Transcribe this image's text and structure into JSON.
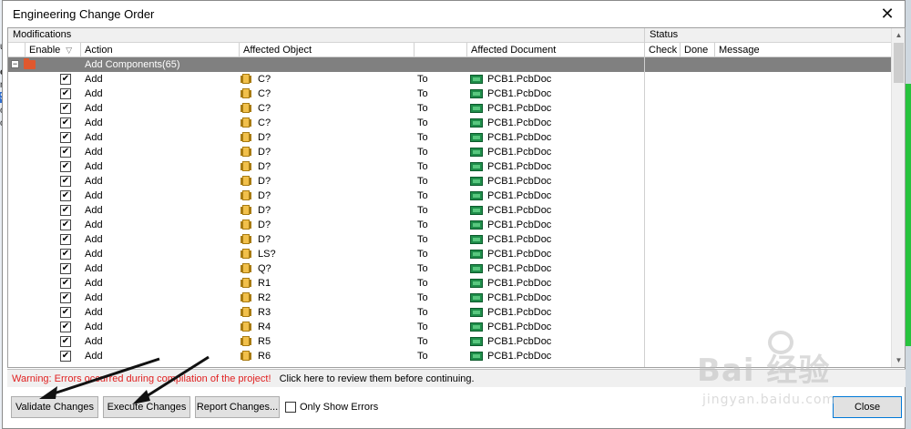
{
  "background": {
    "left_fragments": [
      "ur",
      "c",
      "ne",
      "Se",
      "oc",
      "oc"
    ]
  },
  "dialog": {
    "title": "Engineering Change Order",
    "close_glyph": "✕"
  },
  "grid": {
    "groups": {
      "modifications": "Modifications",
      "status": "Status"
    },
    "columns": {
      "enable": "Enable",
      "action": "Action",
      "affected_object": "Affected Object",
      "affected_document": "Affected Document",
      "check": "Check",
      "done": "Done",
      "message": "Message"
    },
    "group_row": {
      "label": "Add Components(65)",
      "expander": "−"
    },
    "rows": [
      {
        "checked": "✔",
        "action": "Add",
        "object": "C?",
        "to": "To",
        "document": "PCB1.PcbDoc"
      },
      {
        "checked": "✔",
        "action": "Add",
        "object": "C?",
        "to": "To",
        "document": "PCB1.PcbDoc"
      },
      {
        "checked": "✔",
        "action": "Add",
        "object": "C?",
        "to": "To",
        "document": "PCB1.PcbDoc"
      },
      {
        "checked": "✔",
        "action": "Add",
        "object": "C?",
        "to": "To",
        "document": "PCB1.PcbDoc"
      },
      {
        "checked": "✔",
        "action": "Add",
        "object": "D?",
        "to": "To",
        "document": "PCB1.PcbDoc"
      },
      {
        "checked": "✔",
        "action": "Add",
        "object": "D?",
        "to": "To",
        "document": "PCB1.PcbDoc"
      },
      {
        "checked": "✔",
        "action": "Add",
        "object": "D?",
        "to": "To",
        "document": "PCB1.PcbDoc"
      },
      {
        "checked": "✔",
        "action": "Add",
        "object": "D?",
        "to": "To",
        "document": "PCB1.PcbDoc"
      },
      {
        "checked": "✔",
        "action": "Add",
        "object": "D?",
        "to": "To",
        "document": "PCB1.PcbDoc"
      },
      {
        "checked": "✔",
        "action": "Add",
        "object": "D?",
        "to": "To",
        "document": "PCB1.PcbDoc"
      },
      {
        "checked": "✔",
        "action": "Add",
        "object": "D?",
        "to": "To",
        "document": "PCB1.PcbDoc"
      },
      {
        "checked": "✔",
        "action": "Add",
        "object": "D?",
        "to": "To",
        "document": "PCB1.PcbDoc"
      },
      {
        "checked": "✔",
        "action": "Add",
        "object": "LS?",
        "to": "To",
        "document": "PCB1.PcbDoc"
      },
      {
        "checked": "✔",
        "action": "Add",
        "object": "Q?",
        "to": "To",
        "document": "PCB1.PcbDoc"
      },
      {
        "checked": "✔",
        "action": "Add",
        "object": "R1",
        "to": "To",
        "document": "PCB1.PcbDoc"
      },
      {
        "checked": "✔",
        "action": "Add",
        "object": "R2",
        "to": "To",
        "document": "PCB1.PcbDoc"
      },
      {
        "checked": "✔",
        "action": "Add",
        "object": "R3",
        "to": "To",
        "document": "PCB1.PcbDoc"
      },
      {
        "checked": "✔",
        "action": "Add",
        "object": "R4",
        "to": "To",
        "document": "PCB1.PcbDoc"
      },
      {
        "checked": "✔",
        "action": "Add",
        "object": "R5",
        "to": "To",
        "document": "PCB1.PcbDoc"
      },
      {
        "checked": "✔",
        "action": "Add",
        "object": "R6",
        "to": "To",
        "document": "PCB1.PcbDoc"
      }
    ],
    "scroll": {
      "up": "▲",
      "down": "▼"
    }
  },
  "warning": {
    "text": "Warning: Errors occurred during compilation of the project!",
    "link": "Click here to review them before continuing."
  },
  "buttons": {
    "validate": "Validate Changes",
    "execute": "Execute Changes",
    "report": "Report Changes...",
    "only_show_errors": "Only Show Errors",
    "close": "Close"
  },
  "watermark": {
    "brand": "Bai  经验",
    "url": "jingyan.baidu.com"
  },
  "colors": {
    "group_row_bg": "#808080",
    "warning_text": "#e01f1f",
    "pcb_icon": "#1f8d4a",
    "component_icon": "#f1c04b",
    "folder_icon": "#e0582e"
  }
}
